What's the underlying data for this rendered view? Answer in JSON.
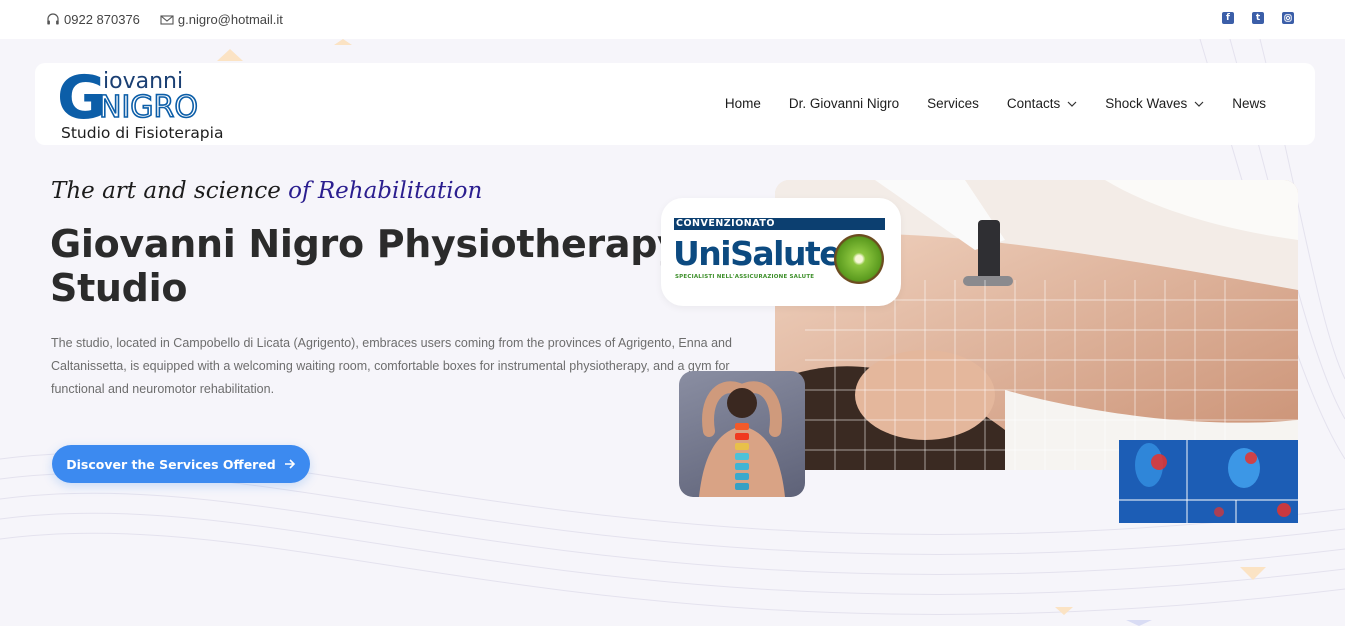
{
  "topbar": {
    "phone": "0922 870376",
    "email": "g.nigro@hotmail.it",
    "social": [
      "facebook-icon",
      "twitter-icon",
      "instagram-icon"
    ]
  },
  "logo": {
    "name_first": "iovanni",
    "name_last": "NIGRO",
    "initial": "G",
    "subtitle": "Studio di Fisioterapia"
  },
  "nav": {
    "items": [
      {
        "label": "Home",
        "dropdown": false
      },
      {
        "label": "Dr. Giovanni Nigro",
        "dropdown": false
      },
      {
        "label": "Services",
        "dropdown": false
      },
      {
        "label": "Contacts",
        "dropdown": true
      },
      {
        "label": "Shock Waves",
        "dropdown": true
      },
      {
        "label": "News",
        "dropdown": false
      }
    ]
  },
  "hero": {
    "tagline_plain": "The art and science ",
    "tagline_accent": "of Rehabilitation",
    "title": "Giovanni Nigro Physiotherapy Studio",
    "description": "The studio, located in Campobello di Licata (Agrigento), embraces users coming from the provinces of Agrigento, Enna and Caltanissetta, is equipped with a welcoming waiting room, comfortable boxes for instrumental physiotherapy, and a gym for functional and neuromotor rehabilitation.",
    "cta_label": "Discover the Services Offered"
  },
  "badge": {
    "header": "CONVENZIONATO",
    "brand": "UniSalute",
    "subtitle": "SPECIALISTI NELL'ASSICURAZIONE SALUTE"
  },
  "colors": {
    "accent": "#3c8af0",
    "tagline_accent": "#2b1e8f",
    "logo_blue": "#0c5ea8"
  }
}
